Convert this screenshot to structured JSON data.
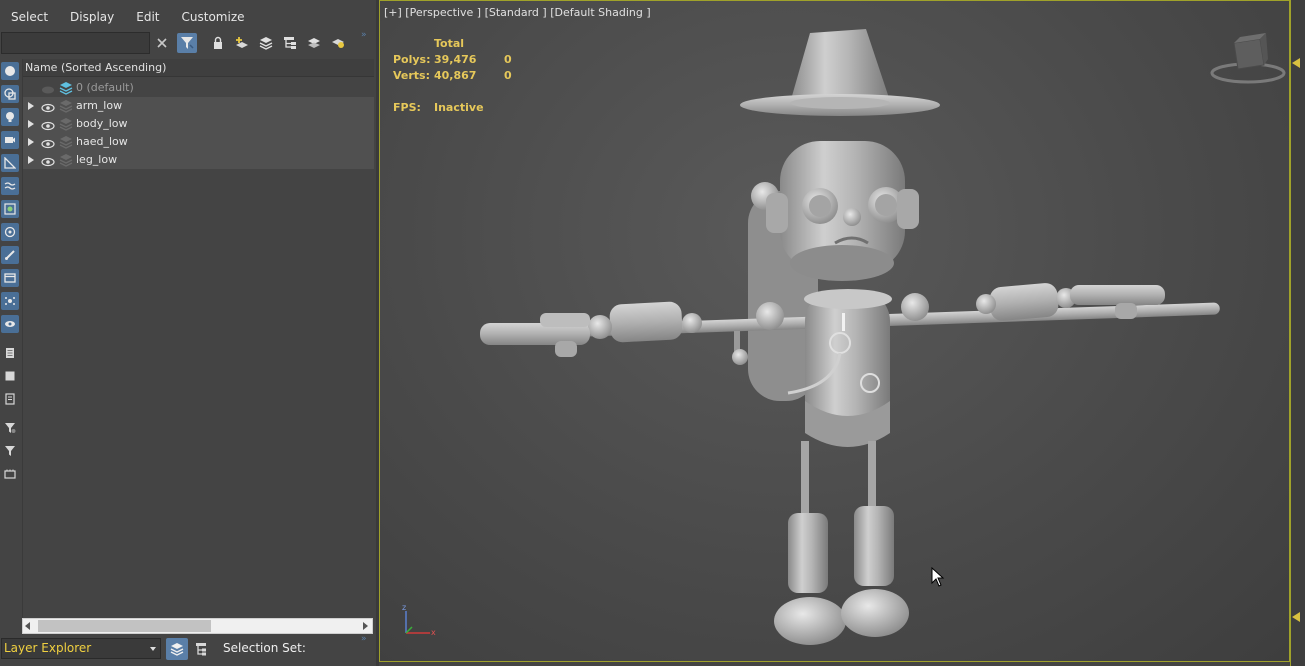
{
  "menu": {
    "items": [
      "Select",
      "Display",
      "Edit",
      "Customize"
    ]
  },
  "toolbar": {
    "search_value": "",
    "icons": [
      "clear-icon",
      "filter-icon",
      "lock-icon",
      "new-layer-icon",
      "add-to-layer-icon",
      "hierarchy-icon",
      "layers-stack-icon",
      "highlight-icon"
    ]
  },
  "list": {
    "header": "Name (Sorted Ascending)",
    "layers": [
      {
        "name": "0 (default)",
        "visible": false,
        "expandable": false,
        "active": true
      },
      {
        "name": "arm_low",
        "visible": true,
        "expandable": true,
        "active": false
      },
      {
        "name": "body_low",
        "visible": true,
        "expandable": true,
        "active": false
      },
      {
        "name": "haed_low",
        "visible": true,
        "expandable": true,
        "active": false
      },
      {
        "name": "leg_low",
        "visible": true,
        "expandable": true,
        "active": false
      }
    ]
  },
  "bottom": {
    "explorer_name": "Layer Explorer",
    "selection_set_label": "Selection Set:"
  },
  "viewport": {
    "label": "[+] [Perspective ] [Standard ] [Default Shading ]",
    "stats": {
      "total_header": "Total",
      "polys_label": "Polys:",
      "polys_value": "39,476",
      "polys_sel": "0",
      "verts_label": "Verts:",
      "verts_value": "40,867",
      "verts_sel": "0",
      "fps_label": "FPS:",
      "fps_value": "Inactive"
    },
    "axis_labels": {
      "z": "z",
      "x": "x"
    }
  },
  "colors": {
    "accent_blue": "#5a7fa8",
    "stats_yellow": "#e6c85a",
    "viewport_border": "#a0a22a",
    "explorer_name": "#f0d040"
  }
}
